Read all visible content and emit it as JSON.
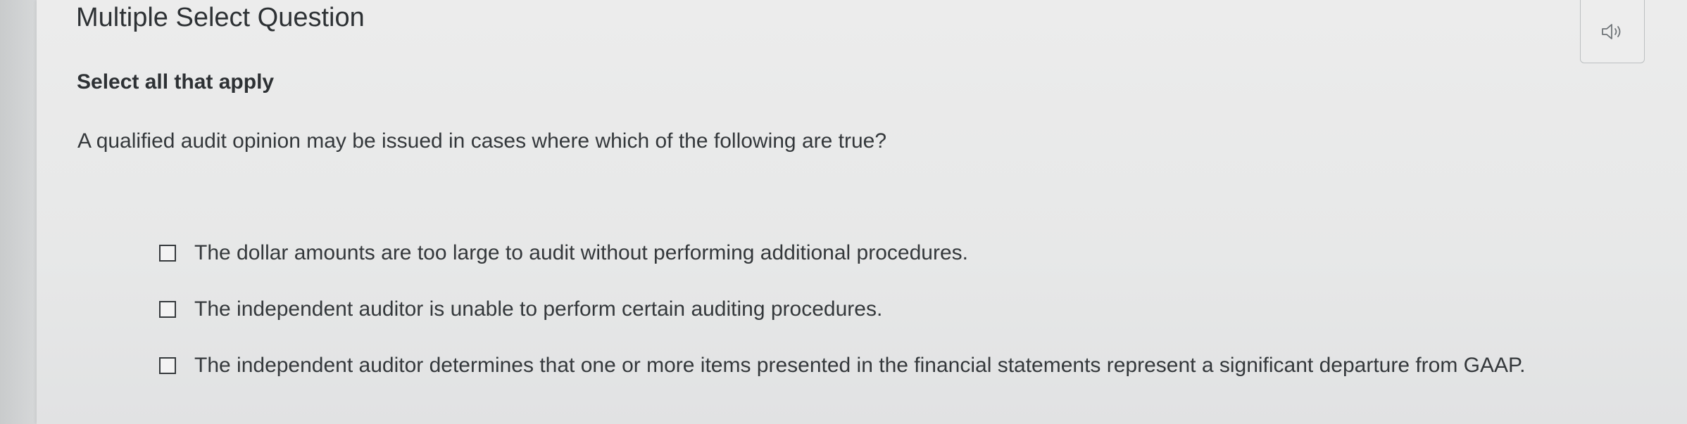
{
  "question": {
    "type_title": "Multiple Select Question",
    "instruction": "Select all that apply",
    "prompt": "A qualified audit opinion may be issued in cases where which of the following are true?",
    "options": [
      {
        "label": "The dollar amounts are too large to audit without performing additional procedures.",
        "checked": false
      },
      {
        "label": "The independent auditor is unable to perform certain auditing procedures.",
        "checked": false
      },
      {
        "label": "The independent auditor determines that one or more items presented in the financial statements represent a significant departure from GAAP.",
        "checked": false
      }
    ]
  },
  "toolbar": {
    "audio_icon": "speaker-icon"
  },
  "colors": {
    "text": "#2d3134",
    "panel_bg": "#ececec",
    "checkbox_border": "#35393c"
  }
}
